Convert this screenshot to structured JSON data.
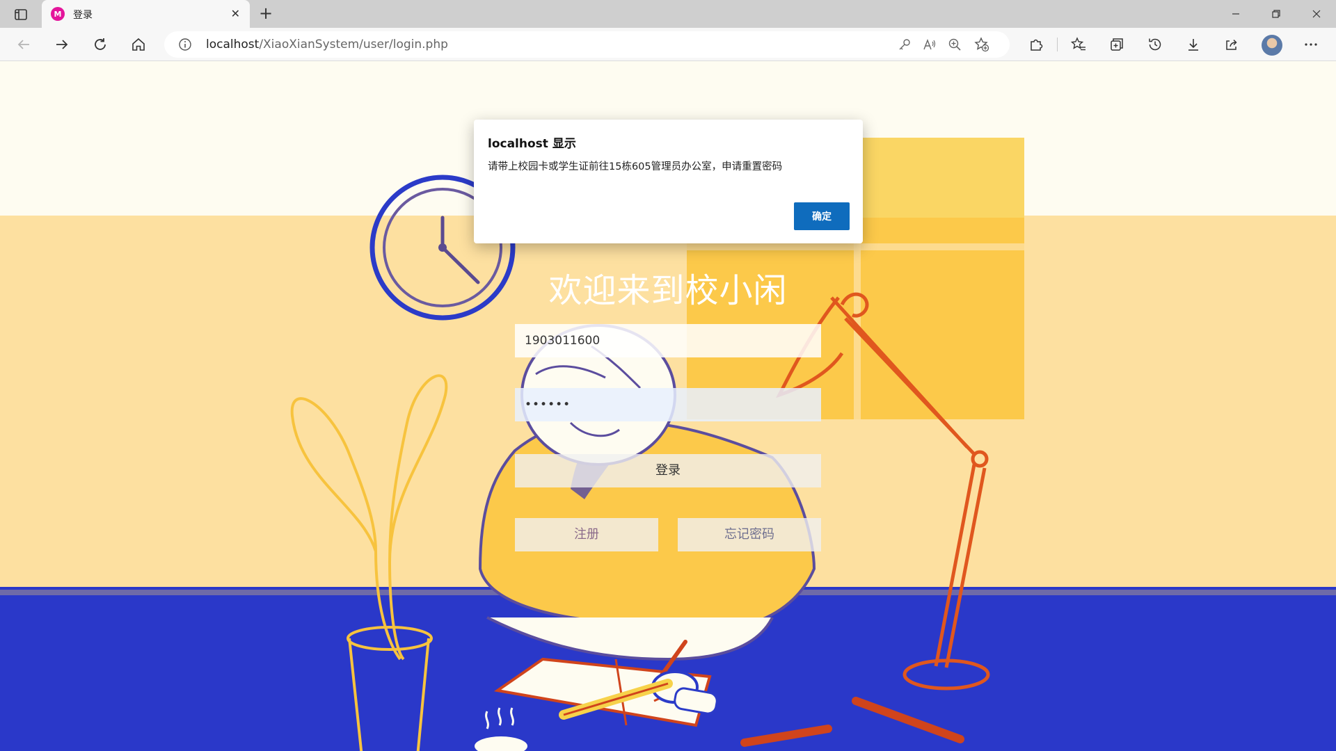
{
  "browser": {
    "tab_title": "登录",
    "tab_favicon_letter": "M",
    "url_host": "localhost",
    "url_path": "/XiaoXianSystem/user/login.php",
    "icons": [
      "sidebar-toggle-icon",
      "back-icon",
      "forward-icon",
      "refresh-icon",
      "home-icon",
      "info-icon",
      "key-icon",
      "read-aloud-icon",
      "zoom-icon",
      "favorite-add-icon",
      "extensions-icon",
      "favorites-icon",
      "collections-icon",
      "history-icon",
      "downloads-icon",
      "share-icon",
      "profile-avatar",
      "more-icon"
    ]
  },
  "page": {
    "welcome": "欢迎来到校小闲",
    "username_value": "1903011600",
    "password_value": "••••••",
    "login_label": "登录",
    "register_label": "注册",
    "forgot_label": "忘记密码"
  },
  "dialog": {
    "title": "localhost 显示",
    "message": "请带上校园卡或学生证前往15栋605管理员办公室，申请重置密码",
    "ok_label": "确定",
    "accent": "#0f6cbd"
  },
  "colors": {
    "wall": "#fde0a0",
    "window": "#fcc94a",
    "desk": "#2a38c9",
    "outline": "#5b4d9e",
    "lamp": "#e0571e"
  }
}
